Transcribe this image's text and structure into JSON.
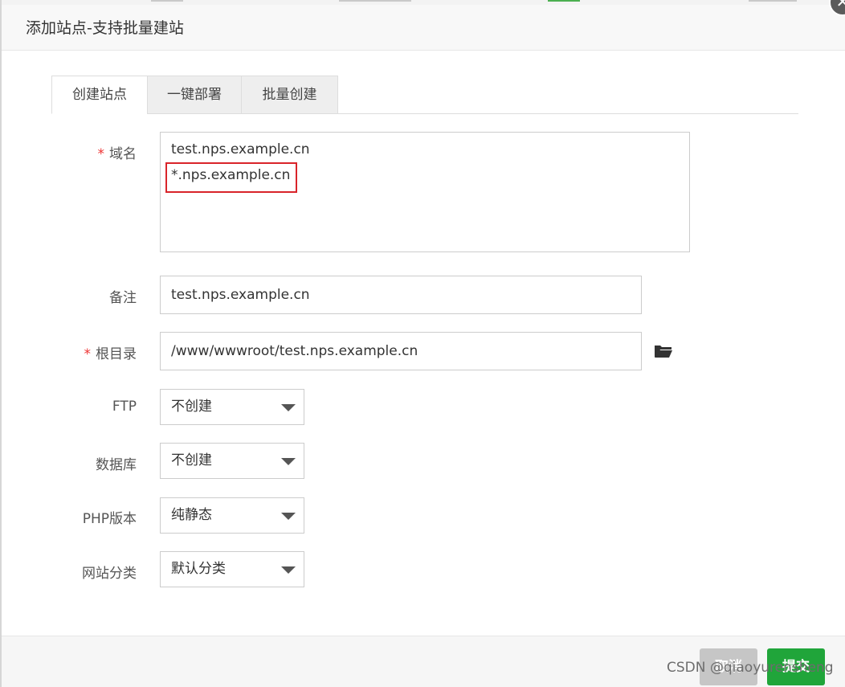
{
  "dialog": {
    "title": "添加站点-支持批量建站",
    "close_icon": "close-icon"
  },
  "tabs": [
    {
      "label": "创建站点",
      "active": true
    },
    {
      "label": "一键部署",
      "active": false
    },
    {
      "label": "批量创建",
      "active": false
    }
  ],
  "form": {
    "domain": {
      "label": "域名",
      "required_mark": "*",
      "lines": [
        "test.nps.example.cn",
        "*.nps.example.cn"
      ]
    },
    "remark": {
      "label": "备注",
      "value": "test.nps.example.cn"
    },
    "root": {
      "label": "根目录",
      "required_mark": "*",
      "value": "/www/wwwroot/test.nps.example.cn",
      "icon": "folder-open-icon"
    },
    "ftp": {
      "label": "FTP",
      "selected": "不创建"
    },
    "database": {
      "label": "数据库",
      "selected": "不创建"
    },
    "php": {
      "label": "PHP版本",
      "selected": "纯静态"
    },
    "category": {
      "label": "网站分类",
      "selected": "默认分类"
    }
  },
  "footer": {
    "cancel_label": "取消",
    "submit_label": "提交"
  },
  "watermark": "CSDN @qiaoyurensheng",
  "colors": {
    "submit": "#20a53a",
    "cancel": "#c6c6c6",
    "required": "#e33333",
    "highlight_box": "#d9242a"
  }
}
